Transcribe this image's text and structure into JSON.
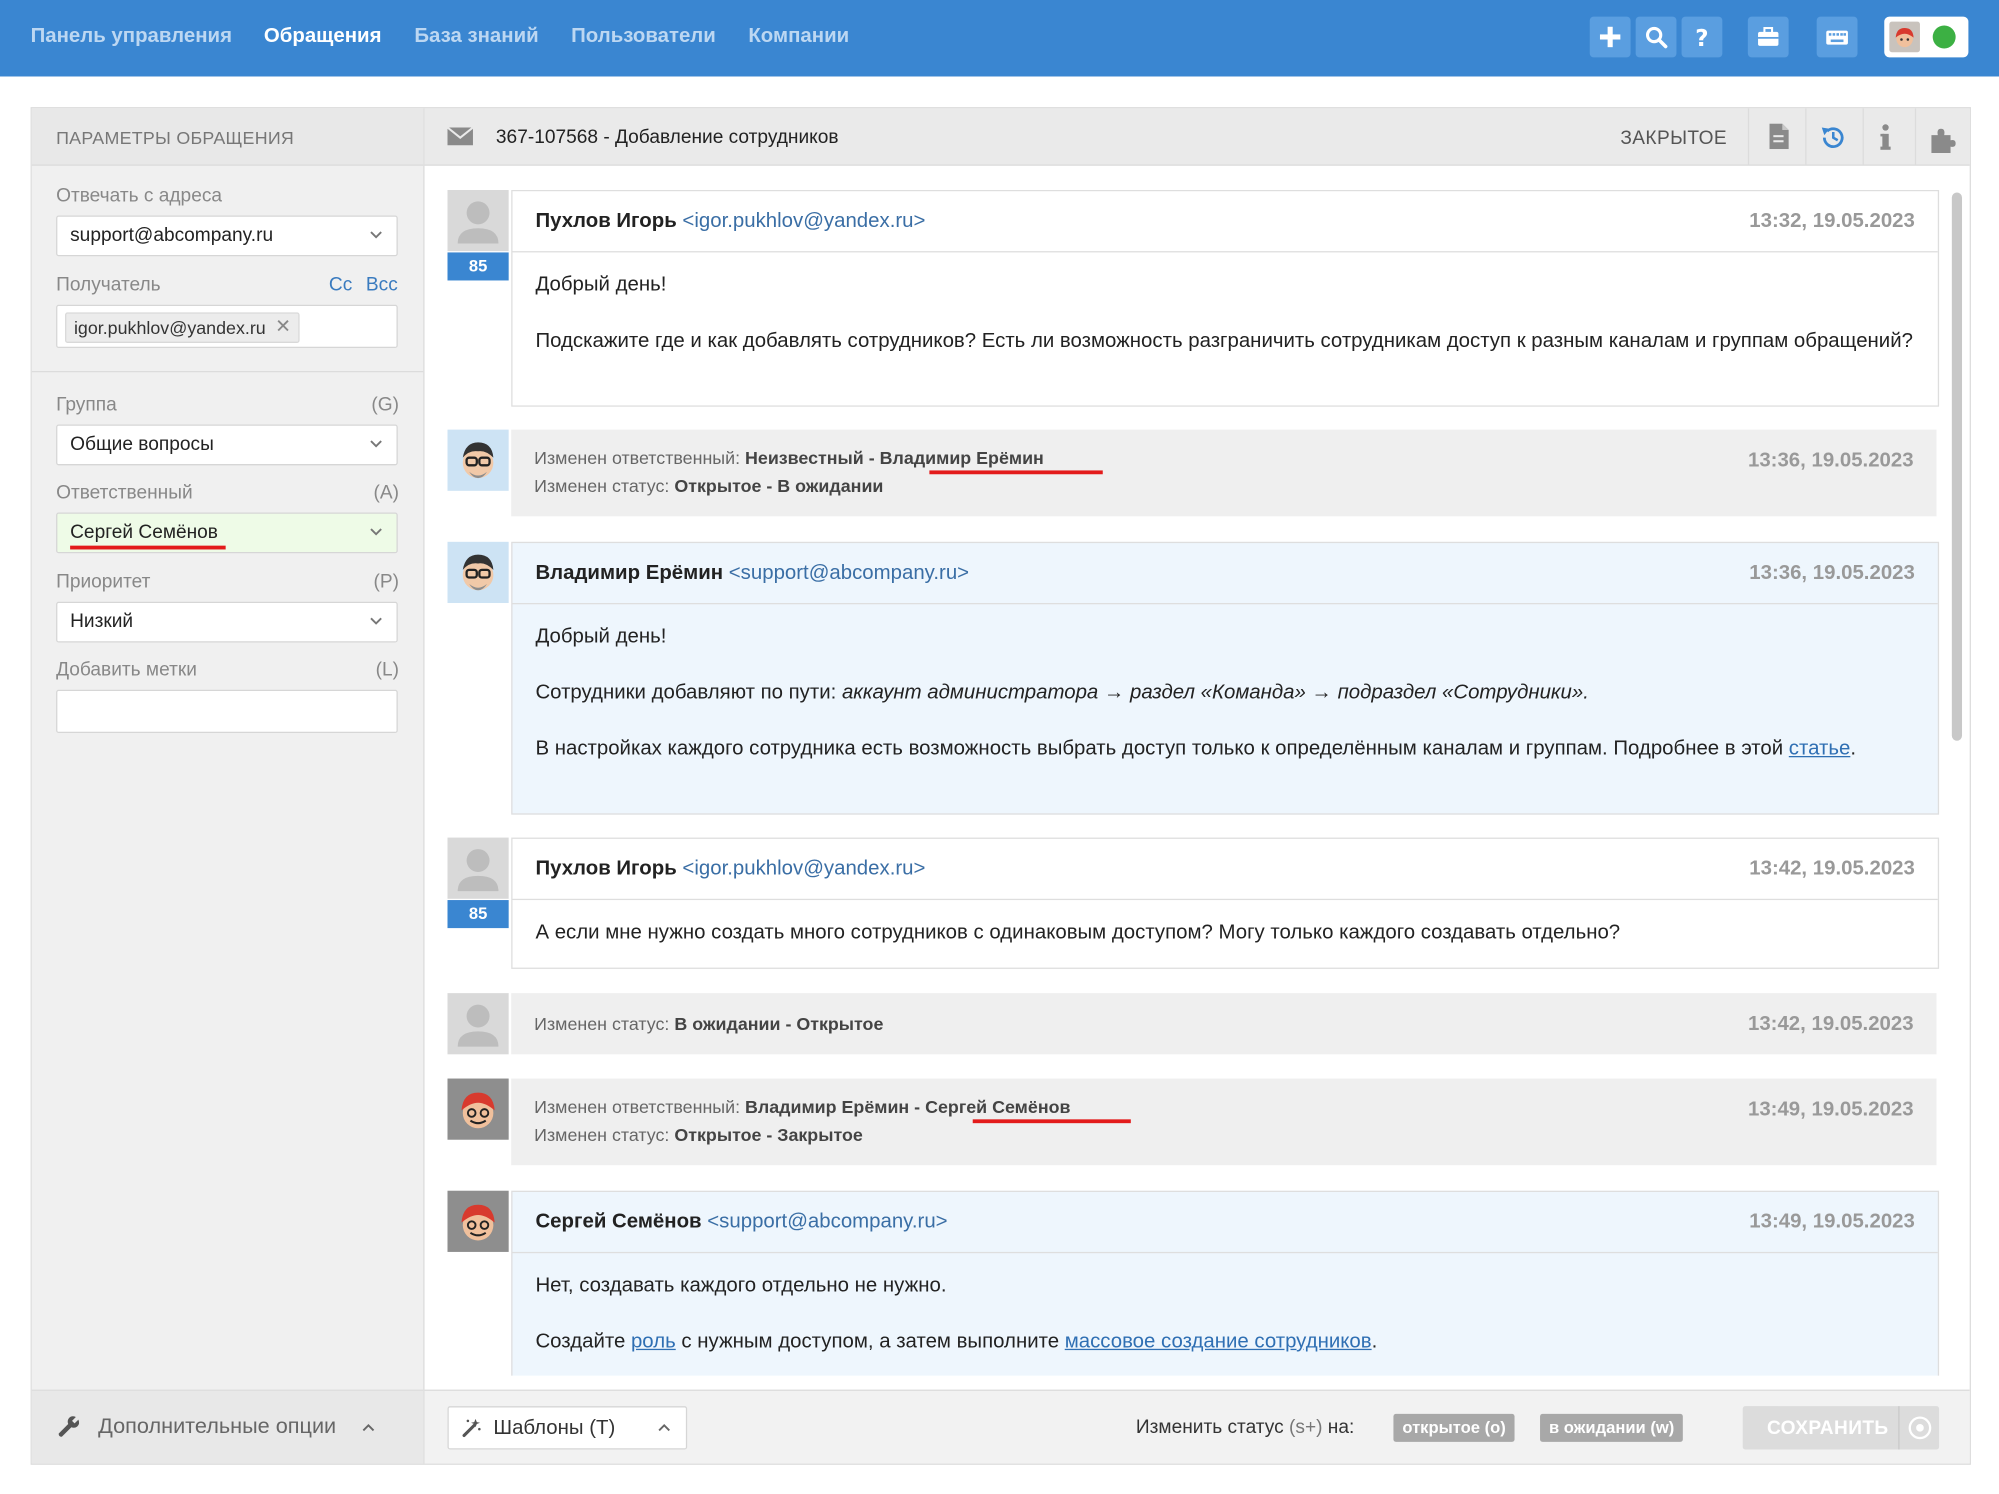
{
  "nav": {
    "items": [
      "Панель управления",
      "Обращения",
      "База знаний",
      "Пользователи",
      "Компании"
    ],
    "active_index": 1,
    "toolbar_icons": [
      "plus-icon",
      "search-icon",
      "help-icon",
      "briefcase-icon",
      "keyboard-icon"
    ],
    "user_status": "online"
  },
  "params": {
    "title": "ПАРАМЕТРЫ ОБРАЩЕНИЯ",
    "reply_from_label": "Отвечать с адреса",
    "reply_from_value": "support@abcompany.ru",
    "recipient_label": "Получатель",
    "cc": "Cc",
    "bcc": "Bcc",
    "recipient_chip": "igor.pukhlov@yandex.ru",
    "group_label": "Группа",
    "group_hotkey": "(G)",
    "group_value": "Общие вопросы",
    "assignee_label": "Ответственный",
    "assignee_hotkey": "(A)",
    "assignee_value": "Сергей Семёнов",
    "priority_label": "Приоритет",
    "priority_hotkey": "(P)",
    "priority_value": "Низкий",
    "tags_label": "Добавить метки",
    "tags_hotkey": "(L)",
    "tags_value": "",
    "extra_options": "Дополнительные опции"
  },
  "ticket": {
    "subject": "367-107568 - Добавление сотрудников",
    "status": "ЗАКРЫТОЕ",
    "header_icons": [
      "pdf-icon",
      "history-icon",
      "info-icon",
      "puzzle-icon"
    ]
  },
  "thread": {
    "m1": {
      "author": "Пухлов Игорь",
      "email": "<igor.pukhlov@yandex.ru>",
      "time": "13:32, 19.05.2023",
      "badge": "85",
      "p1": "Добрый день!",
      "p2": "Подскажите где и как добавлять сотрудников? Есть ли возможность разграничить сотрудникам доступ к разным каналам и группам обращений?"
    },
    "e1": {
      "label1": "Изменен ответственный:",
      "from1": "Неизвестный",
      "dash": " - ",
      "to1": "Владимир Ерёмин",
      "label2": "Изменен статус:",
      "val2": "Открытое - В ожидании",
      "time": "13:36, 19.05.2023"
    },
    "m2": {
      "author": "Владимир Ерёмин",
      "email": "<support@abcompany.ru>",
      "time": "13:36, 19.05.2023",
      "p1": "Добрый день!",
      "p2a": "Сотрудники добавляют по пути: ",
      "p2b": "аккаунт администратора → раздел «Команда» → подраздел «Сотрудники».",
      "p3a": "В настройках каждого сотрудника есть возможность выбрать доступ только к определённым каналам и группам. Подробнее в этой ",
      "p3link": "статье",
      "p3b": "."
    },
    "m3": {
      "author": "Пухлов Игорь",
      "email": "<igor.pukhlov@yandex.ru>",
      "time": "13:42, 19.05.2023",
      "badge": "85",
      "p1": "А если мне нужно создать много сотрудников с одинаковым доступом? Могу только каждого создавать отдельно?"
    },
    "e2": {
      "label": "Изменен статус:",
      "val": "В ожидании - Открытое",
      "time": "13:42, 19.05.2023"
    },
    "e3": {
      "label1": "Изменен ответственный:",
      "from1": "Владимир Ерёмин",
      "dash": " - ",
      "to1": "Сергей Семёнов",
      "label2": "Изменен статус:",
      "val2": "Открытое - Закрытое",
      "time": "13:49, 19.05.2023"
    },
    "m4": {
      "author": "Сергей Семёнов",
      "email": "<support@abcompany.ru>",
      "time": "13:49, 19.05.2023",
      "p1": "Нет, создавать каждого отдельно не нужно.",
      "p2a": "Создайте ",
      "p2link1": "роль",
      "p2b": " с нужным доступом, а затем выполните ",
      "p2link2": "массовое создание сотрудников",
      "p2c": "."
    }
  },
  "bottom": {
    "templates": "Шаблоны (T)",
    "change_status_label": "Изменить статус",
    "change_status_hotkey": "(s+)",
    "change_status_on": "на:",
    "btn_open": "открытое (o)",
    "btn_waiting": "в ожидании (w)",
    "save": "СОХРАНИТЬ"
  },
  "colors": {
    "topbar": "#3a86d1",
    "accent_link": "#2f6fb3",
    "badge": "#3a86d1",
    "highlight_underline": "#e31b1b",
    "assignee_field_bg": "#eefbe7",
    "agent_message_bg": "#eef6fd"
  }
}
